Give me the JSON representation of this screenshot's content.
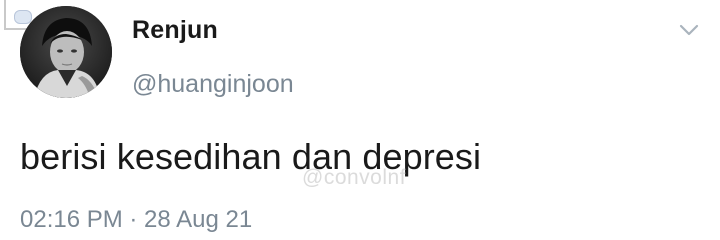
{
  "tweet": {
    "display_name": "Renjun",
    "handle": "@huanginjoon",
    "text": "berisi kesedihan dan depresi",
    "timestamp": "02:16 PM · 28 Aug 21",
    "watermark": "@convolnf"
  },
  "icons": {
    "menu": "chevron-down-icon",
    "avatar": "profile-avatar"
  },
  "colors": {
    "name": "#1a1a1a",
    "secondary": "#7a8793",
    "background": "#ffffff"
  }
}
